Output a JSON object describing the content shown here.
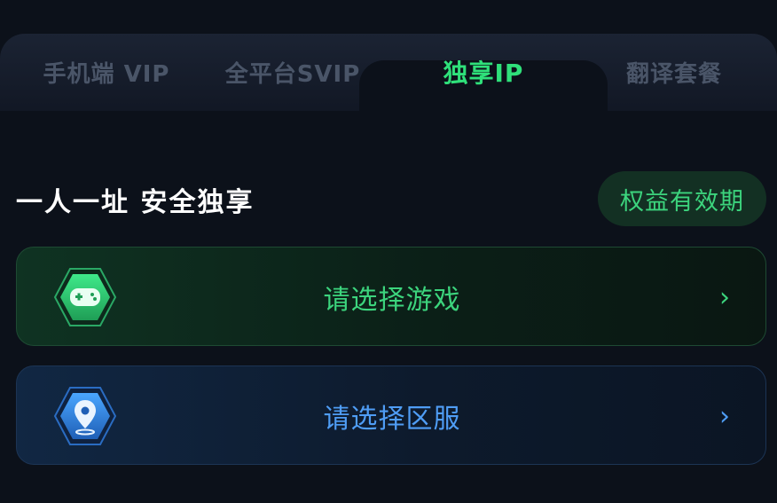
{
  "tabs": [
    {
      "label": "手机端 VIP",
      "active": false
    },
    {
      "label": "全平台SVIP",
      "active": false
    },
    {
      "label": "独享IP",
      "active": true
    },
    {
      "label": "翻译套餐",
      "active": false
    }
  ],
  "section": {
    "title": "一人一址 安全独享",
    "validity_button": "权益有效期"
  },
  "cards": [
    {
      "label": "请选择游戏",
      "icon": "gamepad-icon",
      "chevron": "›"
    },
    {
      "label": "请选择区服",
      "icon": "location-pin-icon",
      "chevron": "›"
    }
  ],
  "colors": {
    "accent_green": "#2fe07a",
    "accent_blue": "#4f9df5",
    "background": "#0c111a"
  }
}
